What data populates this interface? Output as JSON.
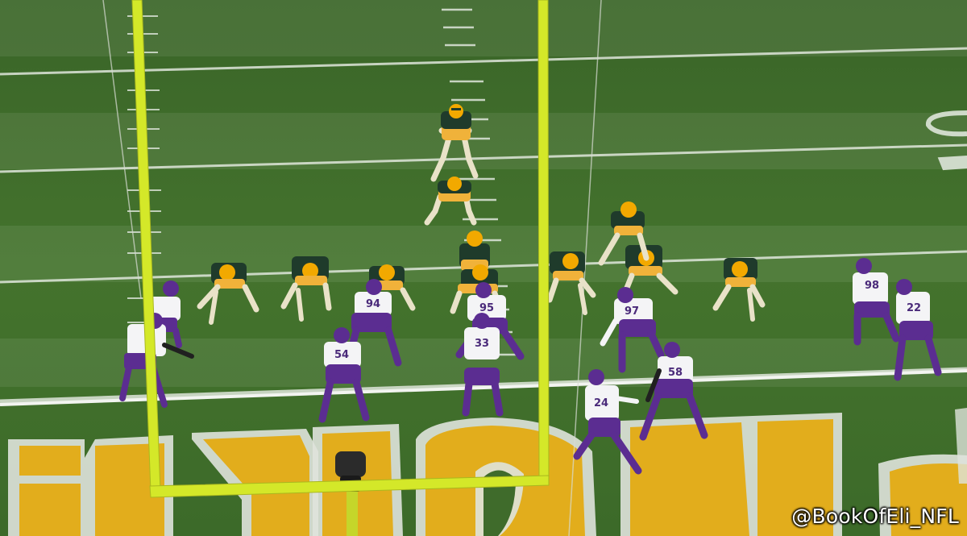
{
  "watermark": "@BookOfEli_NFL",
  "field": {
    "end_zone_lettering": "VIKINGS"
  },
  "colors": {
    "turf": "#3e6b2a",
    "goalpost": "#d4e829",
    "packers_helmet": "#f2a900",
    "packers_jersey": "#1f3b2b",
    "vikings_helmet": "#5b2d91",
    "vikings_pants": "#5b2d91",
    "endzone_gold": "#e2ad1c"
  },
  "defense": {
    "numbers": [
      "94",
      "95",
      "97",
      "54",
      "33",
      "58",
      "24",
      "98",
      "22"
    ]
  }
}
